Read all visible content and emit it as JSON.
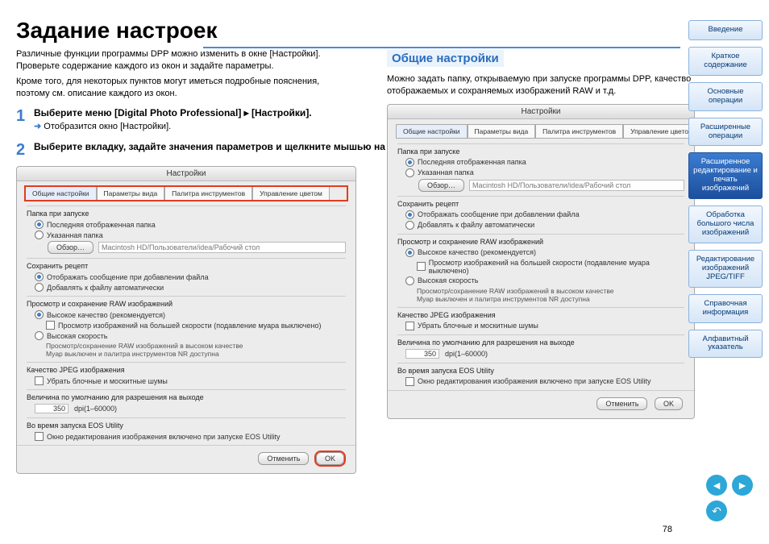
{
  "page_number": "78",
  "title": "Задание настроек",
  "intro1": "Различные функции программы DPP можно изменить в окне [Настройки]. Проверьте содержание каждого из окон и задайте параметры.",
  "intro2": "Кроме того, для некоторых пунктов могут иметься подробные пояснения, поэтому см. описание каждого из окон.",
  "step1": {
    "num": "1",
    "text": "Выберите меню [Digital Photo Professional] ▸ [Настройки].",
    "result": "Отобразится окно [Настройки]."
  },
  "step2": {
    "num": "2",
    "text": "Выберите вкладку, задайте значения параметров и щелкните мышью на кнопке [OK]."
  },
  "subtitle": "Общие настройки",
  "subintro": "Можно задать папку, открываемую при запуске программы DPP, качество отображаемых и сохраняемых изображений RAW и т.д.",
  "win": {
    "title": "Настройки",
    "tabs": [
      "Общие настройки",
      "Параметры вида",
      "Палитра инструментов",
      "Управление цветом"
    ],
    "sec_folder": "Папка при запуске",
    "opt_last": "Последняя отображенная папка",
    "opt_spec": "Указанная папка",
    "browse": "Обзор…",
    "path": "Macintosh HD/Пользователи/idea/Рабочий стол",
    "sec_recipe": "Сохранить рецепт",
    "opt_msg": "Отображать сообщение при добавлении файла",
    "opt_auto": "Добавлять к файлу автоматически",
    "sec_raw": "Просмотр и сохранение RAW изображений",
    "opt_hq": "Высокое качество (рекомендуется)",
    "chk_fast": "Просмотр изображений на большей скорости (подавление муара выключено)",
    "note1": "Просмотр/сохранение RAW изображений в высоком качестве",
    "note2": "Муар выключен и палитра инструментов NR доступна",
    "opt_hs": "Высокая скорость",
    "sec_jpeg": "Качество JPEG изображения",
    "opt_noise": "Убрать блочные и москитные шумы",
    "sec_res": "Величина по умолчанию для разрешения на выходе",
    "res_val": "350",
    "res_range": "dpi(1–60000)",
    "sec_eos": "Во время запуска EOS Utility",
    "opt_eos": "Окно редактирования изображения включено при запуске EOS Utility",
    "cancel": "Отменить",
    "ok": "OK"
  },
  "nav": [
    "Введение",
    "Краткое содержание",
    "Основные операции",
    "Расширенные операции",
    "Расширенное редактирование и печать изображений",
    "Обработка большого числа изображений",
    "Редактирование изображений JPEG/TIFF",
    "Справочная информация",
    "Алфавитный указатель"
  ],
  "nav_active": 4
}
